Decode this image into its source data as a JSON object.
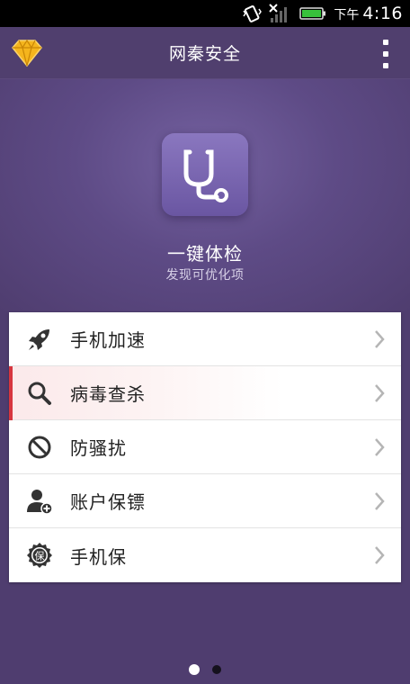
{
  "status_bar": {
    "ampm": "下午",
    "time": "4:16",
    "icons": [
      "vibrate-icon",
      "no-signal-icon",
      "battery-icon"
    ]
  },
  "app_bar": {
    "title": "网秦安全",
    "left_icon": "diamond-icon",
    "right_icon": "overflow-menu-icon"
  },
  "hero": {
    "icon": "stethoscope-icon",
    "title": "一键体检",
    "subtitle": "发现可优化项"
  },
  "menu": {
    "items": [
      {
        "label": "手机加速",
        "icon": "rocket-icon",
        "active": false
      },
      {
        "label": "病毒查杀",
        "icon": "magnifier-icon",
        "active": true
      },
      {
        "label": "防骚扰",
        "icon": "block-icon",
        "active": false
      },
      {
        "label": "账户保镖",
        "icon": "user-shield-icon",
        "active": false
      },
      {
        "label": "手机保",
        "icon": "bao-badge-icon",
        "active": false
      }
    ]
  },
  "pager": {
    "pages": 2,
    "current": 1
  },
  "colors": {
    "background": "#4f3d6f",
    "accent_red": "#d7363f",
    "icon_purple": "#7a66b3"
  }
}
